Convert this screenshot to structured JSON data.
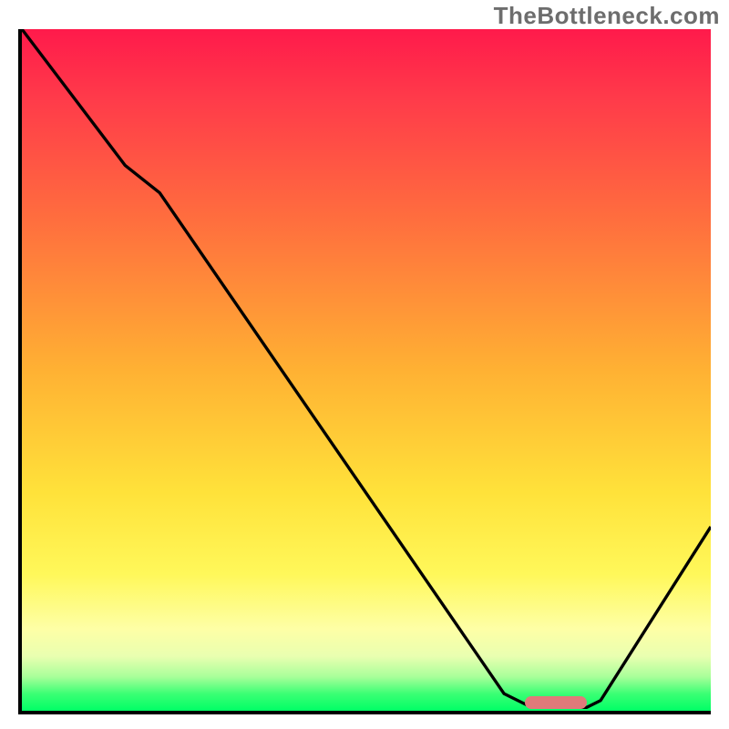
{
  "watermark": "TheBottleneck.com",
  "chart_data": {
    "type": "line",
    "title": "",
    "xlabel": "",
    "ylabel": "",
    "xlim": [
      0,
      100
    ],
    "ylim": [
      0,
      100
    ],
    "grid": false,
    "series": [
      {
        "name": "bottleneck-curve",
        "x": [
          0,
          15,
          20,
          70,
          74,
          82,
          84,
          100
        ],
        "values": [
          100,
          80,
          76,
          2.5,
          0.5,
          0.5,
          1.5,
          27
        ]
      }
    ],
    "annotations": [
      {
        "name": "optimal-range-marker",
        "x_start": 73,
        "x_end": 82,
        "y": 1.2,
        "color": "#e07a7a"
      }
    ],
    "background_gradient": [
      "#ff1a4b",
      "#ff6e3e",
      "#ffe23a",
      "#feffa6",
      "#00ff66"
    ]
  }
}
